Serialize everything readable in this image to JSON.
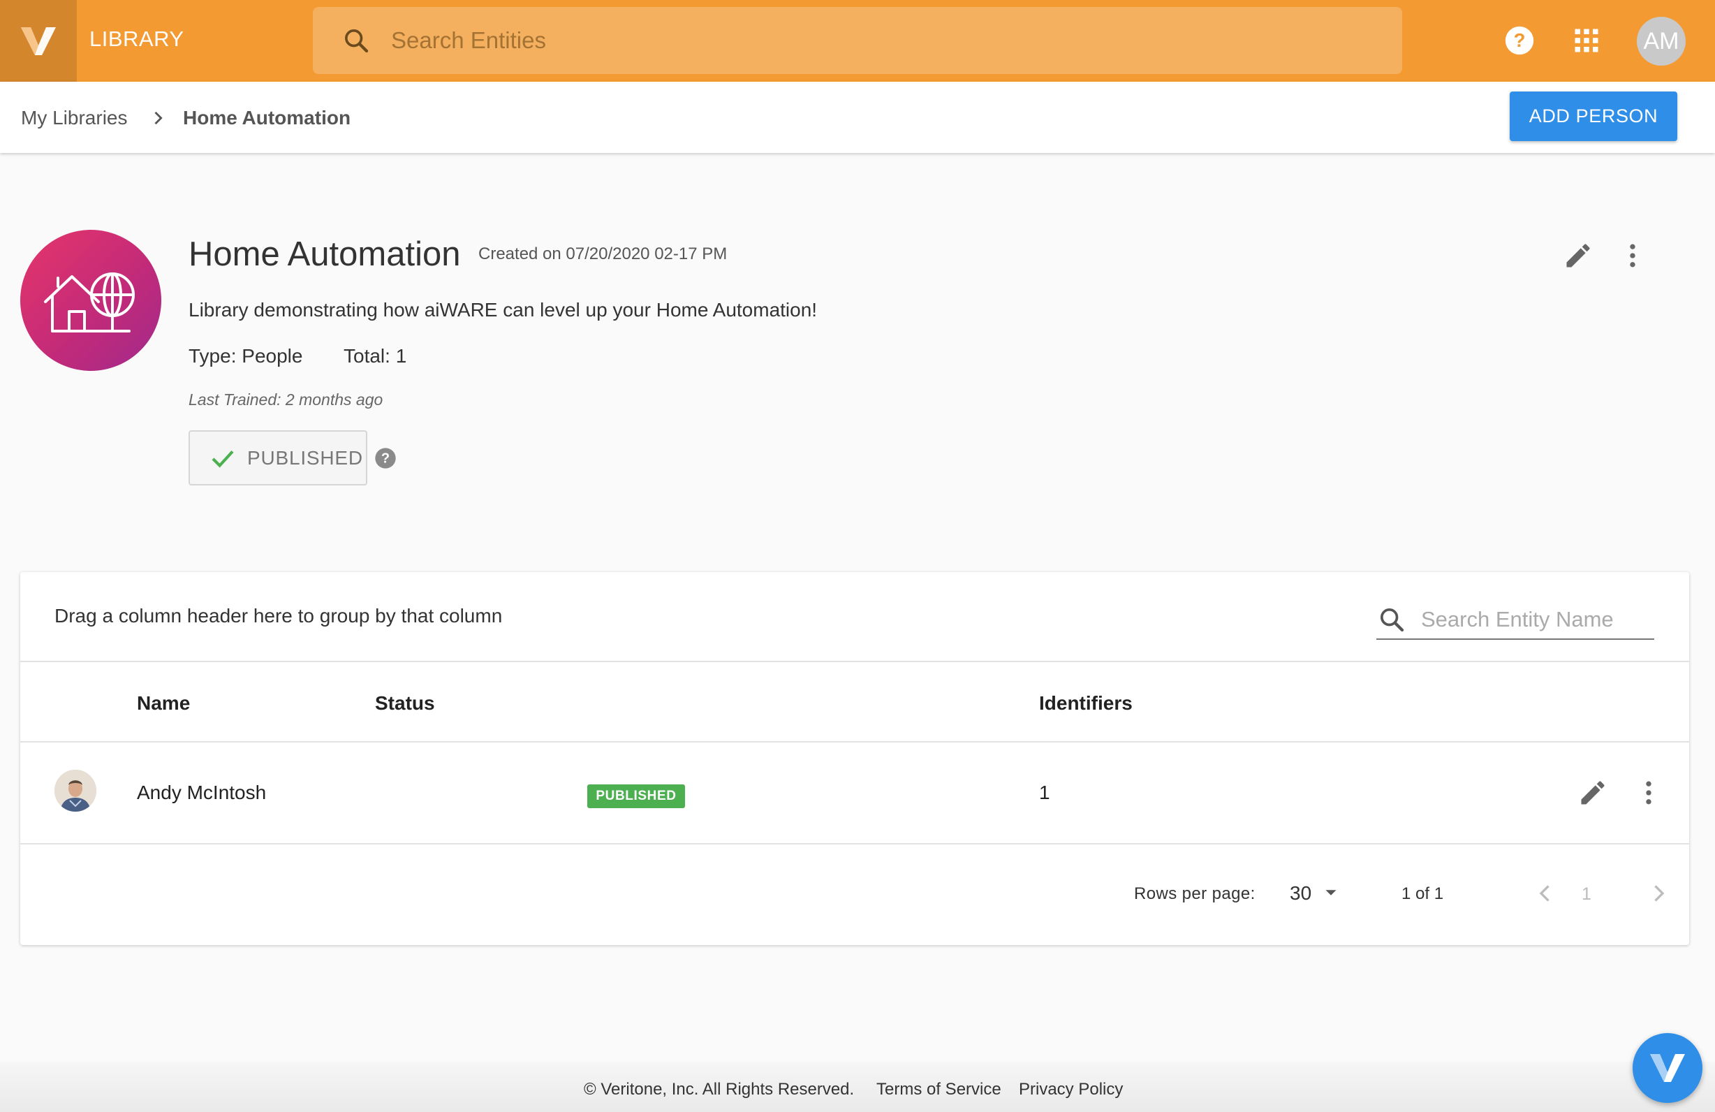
{
  "header": {
    "app_title": "LIBRARY",
    "search_placeholder": "Search Entities",
    "user_initials": "AM",
    "icons": [
      "veritone-logo-icon",
      "search-icon",
      "help-icon",
      "apps-grid-icon"
    ]
  },
  "breadcrumb": {
    "items": [
      "My Libraries",
      "Home Automation"
    ],
    "add_button_label": "ADD PERSON"
  },
  "library": {
    "title": "Home Automation",
    "created": "Created on 07/20/2020 02-17 PM",
    "description": "Library demonstrating how aiWARE can level up your Home Automation!",
    "type": "Type: People",
    "total": "Total: 1",
    "last_trained": "Last Trained: 2 months ago",
    "published_label": "PUBLISHED"
  },
  "table": {
    "group_hint": "Drag a column header here to group by that column",
    "search_placeholder": "Search Entity Name",
    "columns": [
      "Name",
      "Status",
      "Identifiers"
    ],
    "rows": [
      {
        "name": "Andy McIntosh",
        "status": "PUBLISHED",
        "identifiers": "1"
      }
    ],
    "pagination": {
      "rows_per_page_label": "Rows per page:",
      "rows_per_page": "30",
      "range": "1 of 1",
      "page": "1"
    }
  },
  "footer": {
    "copyright": "© Veritone, Inc. All Rights Reserved.",
    "terms": "Terms of Service",
    "privacy": "Privacy Policy"
  },
  "colors": {
    "header_bg": "#f39a32",
    "primary_button": "#2e8ee8",
    "published_badge": "#4caf50"
  }
}
